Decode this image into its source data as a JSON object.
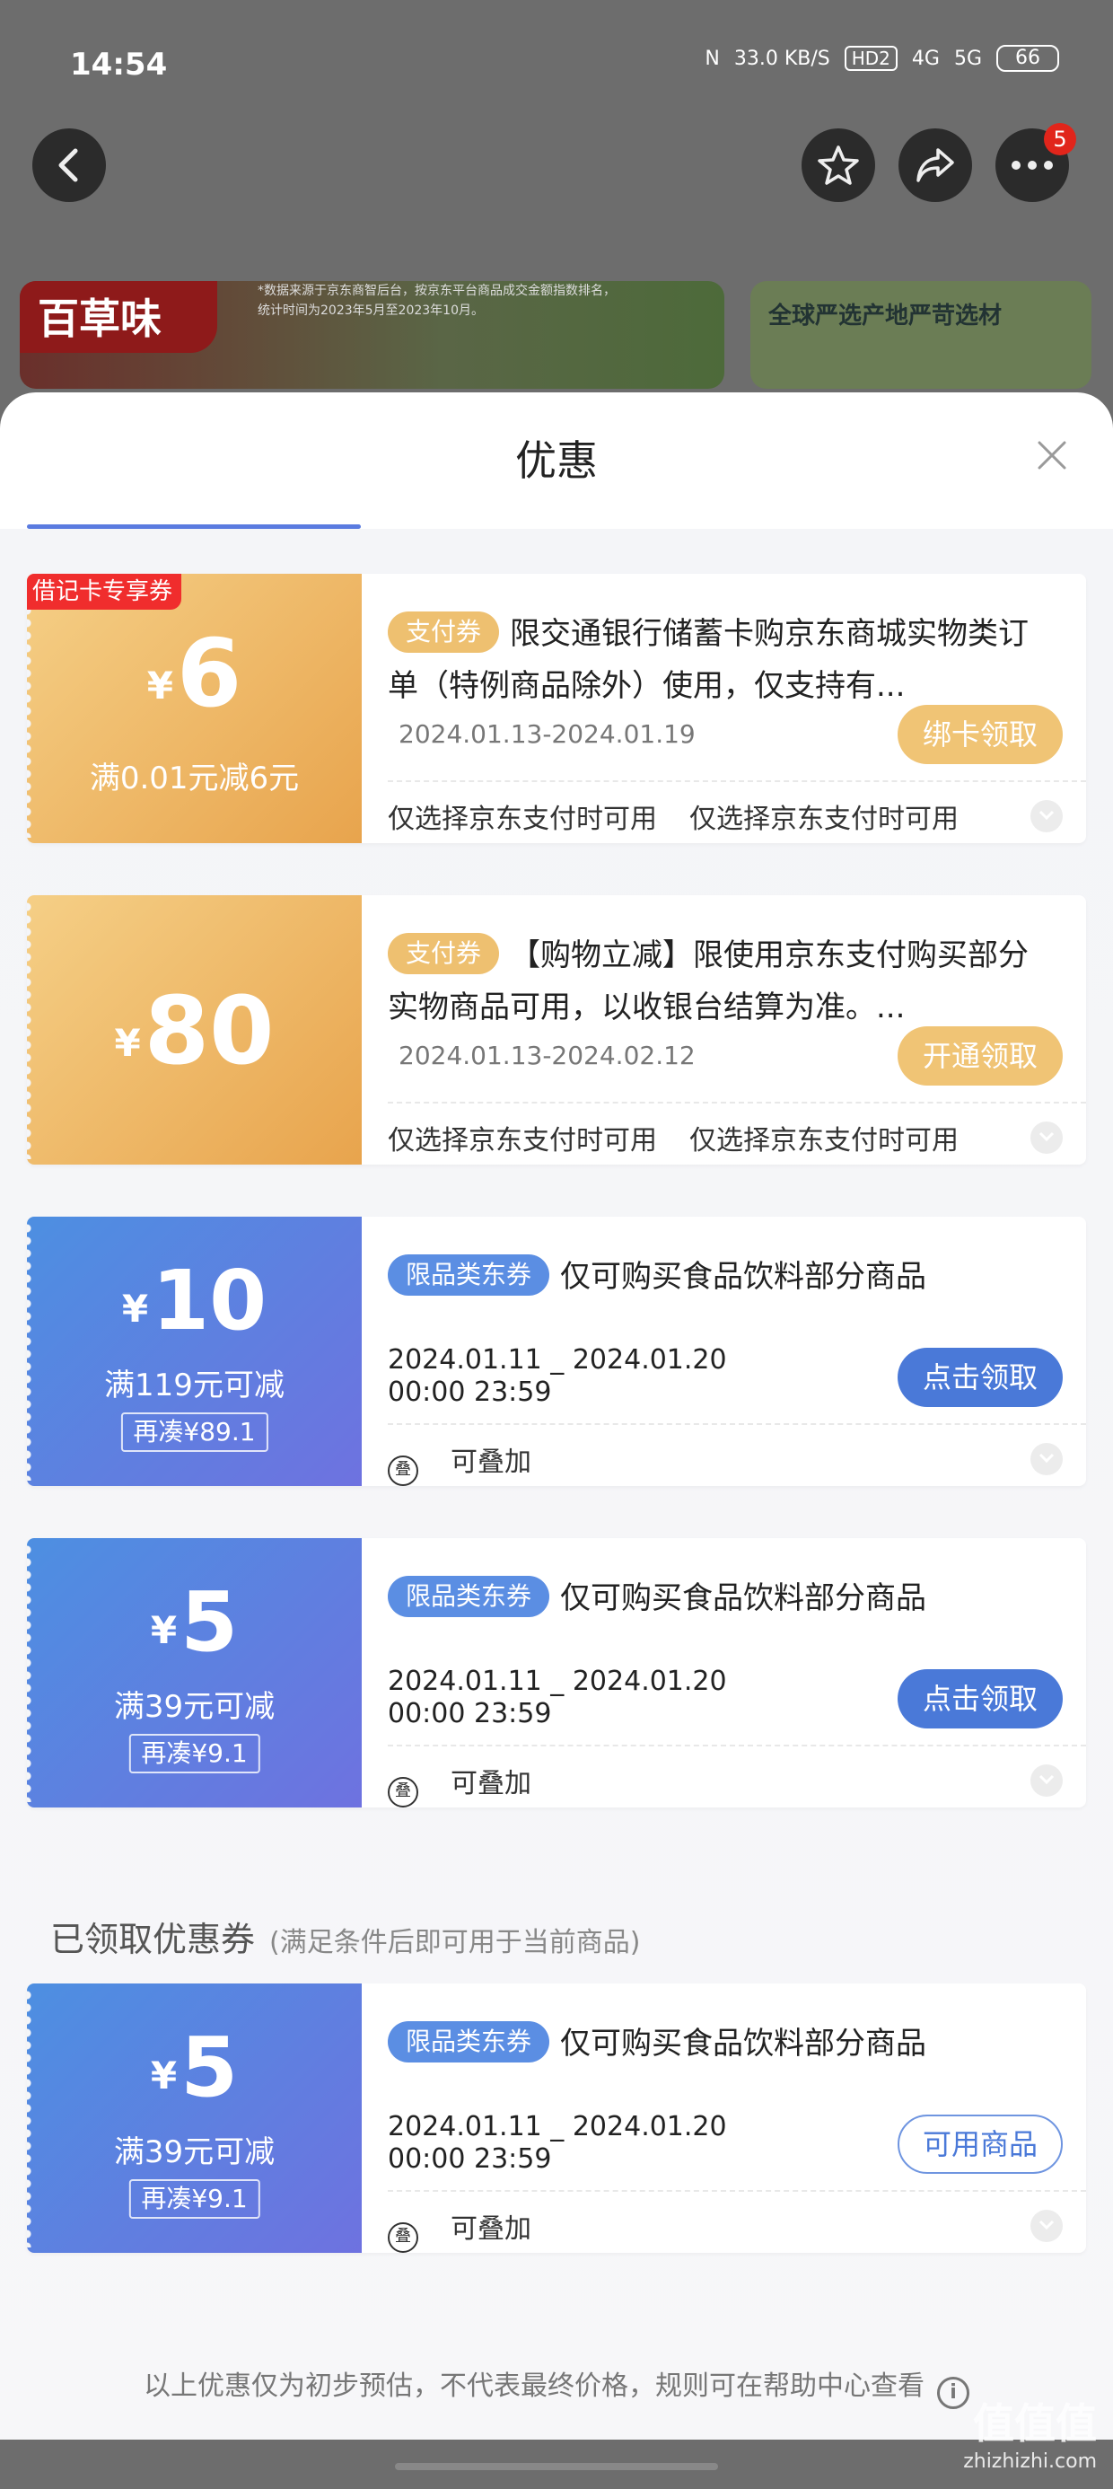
{
  "status_bar": {
    "time": "14:54",
    "nfc": "N",
    "speed": "33.0 KB/S",
    "hd": "HD2",
    "net4g": "4G",
    "net5g": "5G",
    "battery": "66"
  },
  "nav": {
    "badge_count": "5"
  },
  "background": {
    "banner_logo": "百草味",
    "banner_note_1": "*数据来源于京东商智后台，按京东平台商品成交金额指数排名，",
    "banner_note_2": "统计时间为2023年5月至2023年10月。",
    "banner_right_title": "全球严选产地严苛选材"
  },
  "sheet": {
    "title": "优惠"
  },
  "coupons": [
    {
      "corner_tag": "借记卡专享券",
      "currency": "¥",
      "amount": "6",
      "condition": "满0.01元减6元",
      "tag": "支付券",
      "desc": "限交通银行储蓄卡购京东商城实物类订单（特例商品除外）使用，仅支持有...",
      "date": "2024.01.13-2024.01.19",
      "action": "绑卡领取",
      "foot_1": "仅选择京东支付时可用",
      "foot_2": "仅选择京东支付时可用"
    },
    {
      "currency": "¥",
      "amount": "80",
      "tag": "支付券",
      "desc": "【购物立减】限使用京东支付购买部分实物商品可用，以收银台结算为准。...",
      "date": "2024.01.13-2024.02.12",
      "action": "开通领取",
      "foot_1": "仅选择京东支付时可用",
      "foot_2": "仅选择京东支付时可用"
    },
    {
      "currency": "¥",
      "amount": "10",
      "condition": "满119元可减",
      "makeup": "再凑¥89.1",
      "tag": "限品类东券",
      "desc": "仅可购买食品饮料部分商品",
      "date_line1": "2024.01.11 _ 2024.01.20",
      "date_line2": "00:00 23:59",
      "action": "点击领取",
      "stack_icon": "叠",
      "foot_1": "可叠加"
    },
    {
      "currency": "¥",
      "amount": "5",
      "condition": "满39元可减",
      "makeup": "再凑¥9.1",
      "tag": "限品类东券",
      "desc": "仅可购买食品饮料部分商品",
      "date_line1": "2024.01.11 _ 2024.01.20",
      "date_line2": "00:00 23:59",
      "action": "点击领取",
      "stack_icon": "叠",
      "foot_1": "可叠加"
    }
  ],
  "received": {
    "title": "已领取优惠券",
    "subtitle": "(满足条件后即可用于当前商品)",
    "coupon": {
      "currency": "¥",
      "amount": "5",
      "condition": "满39元可减",
      "makeup": "再凑¥9.1",
      "tag": "限品类东券",
      "desc": "仅可购买食品饮料部分商品",
      "date_line1": "2024.01.11 _ 2024.01.20",
      "date_line2": "00:00 23:59",
      "action": "可用商品",
      "stack_icon": "叠",
      "foot_1": "可叠加"
    }
  },
  "footer": {
    "note": "以上优惠仅为初步预估，不代表最终价格，规则可在帮助中心查看",
    "info_glyph": "i"
  },
  "watermark": {
    "big": "值值值",
    "small": "zhizhizhi.com"
  }
}
